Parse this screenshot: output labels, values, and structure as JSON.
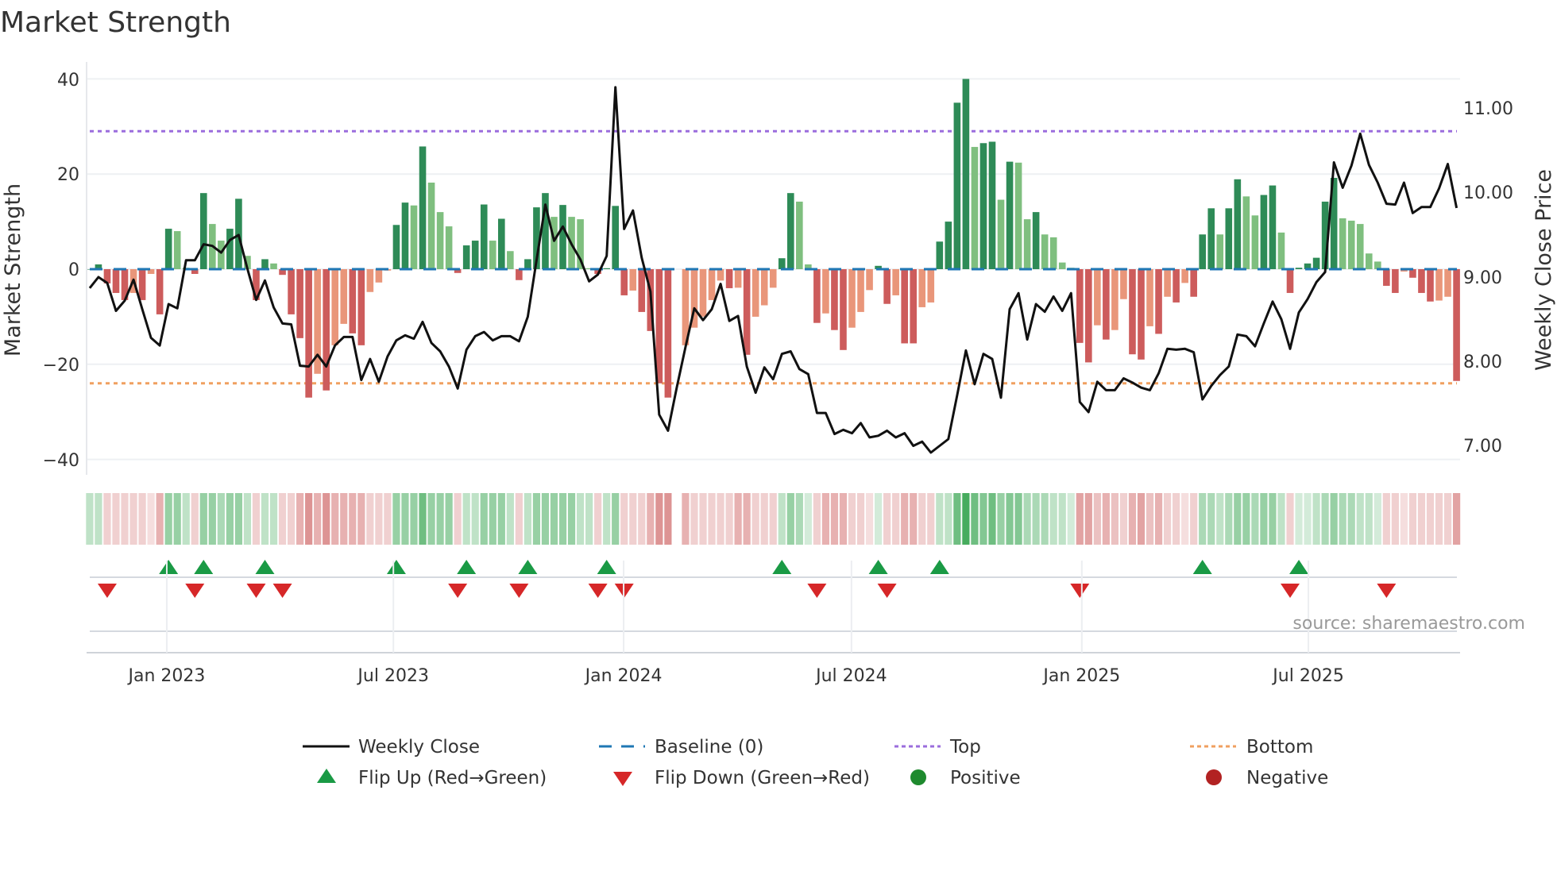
{
  "chart_data": {
    "type": "bar",
    "title": "Market Strength",
    "ylabel": "Market Strength",
    "y2label": "Weekly Close Price",
    "ylim": [
      -42,
      43
    ],
    "y2lim": [
      6.82,
      11.33
    ],
    "yticks": [
      "40",
      "20",
      "0",
      "−20",
      "−40"
    ],
    "ytick_values": [
      40,
      20,
      0,
      -20,
      -40
    ],
    "y2ticks": [
      "11.00",
      "10.00",
      "9.00",
      "8.00",
      "7.00"
    ],
    "y2tick_values": [
      11,
      10,
      9,
      8,
      7
    ],
    "x_ticks": [
      {
        "label": "Jan 2023",
        "week": 8.8
      },
      {
        "label": "Jul 2023",
        "week": 34.66
      },
      {
        "label": "Jan 2024",
        "week": 60.94
      },
      {
        "label": "Jul 2024",
        "week": 86.94
      },
      {
        "label": "Jan 2025",
        "week": 113.23
      },
      {
        "label": "Jul 2025",
        "week": 139.09
      }
    ],
    "reference_lines": {
      "baseline": 0,
      "top": 29,
      "bottom": -24
    },
    "strength": [
      0,
      1,
      -3,
      -5,
      -6.5,
      -5,
      -6.5,
      -1,
      -9.5,
      8.5,
      8,
      0.3,
      -1,
      16,
      9.5,
      6,
      8.5,
      14.8,
      2.8,
      -6.5,
      2.1,
      1.2,
      -1.2,
      -9.5,
      -14.5,
      -27,
      -22,
      -25.5,
      -16,
      -11.5,
      -13.5,
      -16,
      -4.8,
      -2.8,
      -0.3,
      9.3,
      14,
      13.4,
      25.8,
      18.2,
      12,
      9,
      -0.8,
      5,
      6,
      13.6,
      6,
      10.6,
      3.8,
      -2.3,
      2.1,
      13,
      16,
      11,
      13.5,
      11,
      10.5,
      0.2,
      -1,
      0.2,
      13.3,
      -5.5,
      -4.5,
      -9,
      -13,
      -24,
      -27,
      null,
      -16,
      -12.3,
      -10,
      -6.5,
      -2.4,
      -4,
      -3.9,
      -18,
      -10,
      -7.6,
      -3.9,
      2.3,
      16,
      14.2,
      1,
      -11.3,
      -9.3,
      -12.8,
      -17,
      -12.3,
      -9,
      -4.4,
      0.7,
      -7.3,
      -5.5,
      -15.6,
      -15.6,
      -8,
      -7,
      5.8,
      10,
      35,
      40,
      25.7,
      26.5,
      26.8,
      14.6,
      22.6,
      22.4,
      10.5,
      12,
      7.3,
      6.7,
      1.4,
      0.3,
      -15.5,
      -19.6,
      -11.8,
      -14.8,
      -12.8,
      -6.3,
      -17.9,
      -19,
      -12,
      -13.6,
      -5.8,
      -7,
      -2.9,
      -5.8,
      7.3,
      12.8,
      7.3,
      12.8,
      18.9,
      15.3,
      11.3,
      15.6,
      17.6,
      7.7,
      -5,
      0.3,
      1.2,
      2.4,
      14.2,
      19.2,
      10.7,
      10.2,
      9.5,
      3.3,
      1.6,
      -3.5,
      -5,
      -0.5,
      -1.8,
      -5,
      -6.8,
      -6.6,
      -5.8,
      -23.5
    ],
    "weekly_close": [
      8.87,
      9.0,
      8.93,
      8.6,
      8.72,
      8.97,
      8.62,
      8.28,
      8.19,
      8.68,
      8.63,
      9.2,
      9.2,
      9.39,
      9.37,
      9.29,
      9.44,
      9.5,
      9.1,
      8.73,
      8.96,
      8.64,
      8.45,
      8.44,
      7.95,
      7.94,
      8.08,
      7.94,
      8.19,
      8.29,
      8.29,
      7.78,
      8.03,
      7.76,
      8.06,
      8.25,
      8.31,
      8.27,
      8.47,
      8.22,
      8.12,
      7.94,
      7.68,
      8.14,
      8.3,
      8.35,
      8.25,
      8.3,
      8.3,
      8.24,
      8.53,
      9.2,
      9.86,
      9.43,
      9.6,
      9.39,
      9.21,
      8.95,
      9.03,
      9.25,
      11.25,
      9.57,
      9.79,
      9.23,
      8.83,
      7.37,
      7.18,
      7.69,
      8.17,
      8.63,
      8.49,
      8.62,
      8.92,
      8.48,
      8.54,
      7.94,
      7.63,
      7.93,
      7.79,
      8.09,
      8.12,
      7.91,
      7.85,
      7.39,
      7.39,
      7.14,
      7.19,
      7.15,
      7.27,
      7.1,
      7.12,
      7.18,
      7.1,
      7.15,
      7.0,
      7.05,
      6.92,
      7.0,
      7.08,
      7.6,
      8.13,
      7.73,
      8.09,
      8.03,
      7.57,
      8.62,
      8.81,
      8.26,
      8.68,
      8.59,
      8.77,
      8.6,
      8.81,
      7.52,
      7.4,
      7.76,
      7.66,
      7.66,
      7.8,
      7.75,
      7.69,
      7.66,
      7.86,
      8.15,
      8.14,
      8.15,
      8.11,
      7.55,
      7.71,
      7.84,
      7.94,
      8.32,
      8.3,
      8.18,
      8.45,
      8.71,
      8.5,
      8.15,
      8.58,
      8.74,
      8.94,
      9.06,
      10.36,
      10.06,
      10.32,
      10.7,
      10.33,
      10.12,
      9.87,
      9.86,
      10.12,
      9.76,
      9.83,
      9.83,
      10.05,
      10.34,
      9.82
    ],
    "heat_strip": [
      1,
      1,
      -1,
      -1,
      -1,
      -1,
      -1,
      -0.5,
      -2,
      2,
      2,
      1,
      -1,
      2,
      2,
      1.5,
      2,
      2,
      1,
      -1,
      1,
      1,
      -1,
      -1,
      -2,
      -3,
      -2,
      -3,
      -2,
      -2,
      -2,
      -2,
      -1,
      -1,
      -1,
      2,
      2,
      2,
      3,
      2,
      2,
      2,
      -1,
      1,
      1,
      2,
      2,
      2,
      1,
      -1,
      1,
      2,
      2,
      2,
      2,
      2,
      1,
      1,
      -1,
      1,
      2,
      -1,
      -1,
      -1,
      -2,
      -3,
      -3,
      null,
      -2,
      -1,
      -1,
      -1,
      -1,
      -1,
      -2,
      -2,
      -1,
      -1,
      -1,
      1,
      2,
      1.5,
      0.5,
      -1,
      -2,
      -2,
      -2,
      -1,
      -1,
      -0.5,
      0.5,
      -1,
      -1,
      -2,
      -2,
      -1,
      -1,
      1,
      1,
      3,
      4,
      3,
      2.5,
      3,
      2,
      2.5,
      2.5,
      1.5,
      1.5,
      1.5,
      1,
      1,
      0.5,
      -2.5,
      -2.5,
      -1.5,
      -2,
      -1.5,
      -1,
      -2,
      -2.5,
      -1.5,
      -2,
      -1,
      -1,
      -0.5,
      -1,
      1.5,
      1.5,
      1,
      1.5,
      2,
      2,
      1.5,
      2,
      2,
      1,
      -1,
      0.5,
      0.5,
      1,
      1.5,
      2,
      1.5,
      1.5,
      1,
      1,
      0.5,
      -1,
      -1,
      -0.5,
      -1,
      -1,
      -1,
      -1,
      -1,
      -2.5
    ],
    "flip_up_weeks": [
      9,
      13,
      20,
      35,
      43,
      50,
      59,
      79,
      90,
      97,
      127,
      138
    ],
    "flip_down_weeks": [
      2,
      12,
      19,
      22,
      42,
      49,
      58,
      61,
      83,
      91,
      113,
      137,
      148
    ],
    "legend": {
      "placement": "bottom",
      "items": [
        {
          "label": "Weekly Close",
          "symbol": "line"
        },
        {
          "label": "Baseline (0)",
          "symbol": "dash"
        },
        {
          "label": "Top",
          "symbol": "dot-purple"
        },
        {
          "label": "Bottom",
          "symbol": "dot-orange"
        },
        {
          "label": "Flip Up (Red→Green)",
          "symbol": "triangle-up"
        },
        {
          "label": "Flip Down (Green→Red)",
          "symbol": "triangle-down"
        },
        {
          "label": "Positive",
          "symbol": "circle-green"
        },
        {
          "label": "Negative",
          "symbol": "circle-red"
        }
      ]
    },
    "source": "source: sharemaestro.com"
  },
  "colors": {
    "pos_strong": "#2e8b57",
    "pos_weak": "#7fbf7f",
    "neg_strong": "#cd5c5c",
    "neg_weak": "#e9967a",
    "close": "#111111",
    "baseline": "#1f77b4",
    "top": "#9b6ddd",
    "bottom": "#f0a060",
    "flip_up": "#1a9a45",
    "flip_down": "#d62728",
    "positive": "#1e8a2e",
    "negative": "#b22222"
  }
}
